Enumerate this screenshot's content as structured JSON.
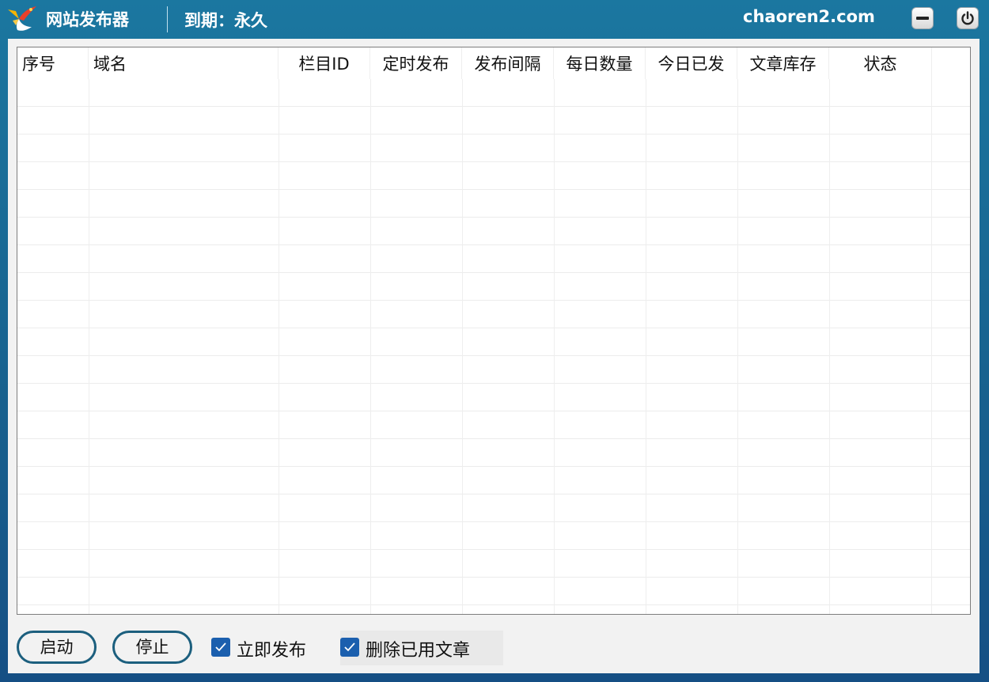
{
  "titlebar": {
    "app_title": "网站发布器",
    "expiry": "到期：永久",
    "domain": "chaoren2.com",
    "logo_icon": "bird-logo-icon",
    "minimize_icon": "minimize-icon",
    "power_icon": "power-icon"
  },
  "grid": {
    "columns": [
      "序号",
      "域名",
      "栏目ID",
      "定时发布",
      "发布间隔",
      "每日数量",
      "今日已发",
      "文章库存",
      "状态"
    ],
    "rows": []
  },
  "controls": {
    "start_label": "启动",
    "stop_label": "停止",
    "publish_now_label": "立即发布",
    "publish_now_checked": true,
    "delete_used_label": "删除已用文章",
    "delete_used_checked": true
  },
  "colors": {
    "window_blue": "#1b77a0",
    "checkbox_blue": "#1b5fae",
    "button_border": "#1c5f7e"
  }
}
